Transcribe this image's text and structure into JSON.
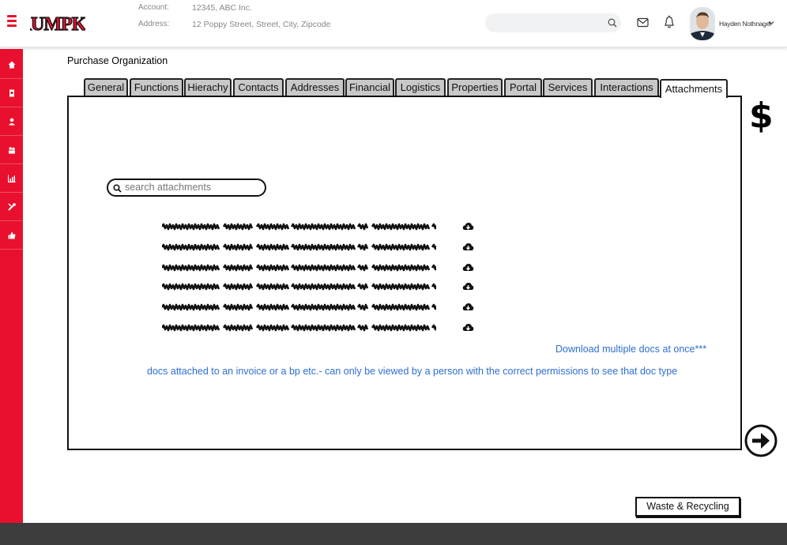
{
  "app": {
    "logo_text": "RUMPKE"
  },
  "header": {
    "account_label": "Account:",
    "account_value": "12345, ABC Inc.",
    "address_label": "Address:",
    "address_value": "12 Poppy Street, Street, City, Zipcode",
    "search_placeholder": "",
    "user_name": "Hayden Nothnagel"
  },
  "sidebar": {
    "items": [
      {
        "icon": "home-icon"
      },
      {
        "icon": "document-icon"
      },
      {
        "icon": "user-icon"
      },
      {
        "icon": "users-icon"
      },
      {
        "icon": "chart-icon"
      },
      {
        "icon": "tools-icon"
      },
      {
        "icon": "thumbs-up-icon"
      }
    ]
  },
  "page": {
    "title": "Purchase Organization"
  },
  "tabs": [
    {
      "label": "General"
    },
    {
      "label": "Functions"
    },
    {
      "label": "Hierachy"
    },
    {
      "label": "Contacts"
    },
    {
      "label": "Addresses"
    },
    {
      "label": "Financial"
    },
    {
      "label": "Logistics"
    },
    {
      "label": "Properties"
    },
    {
      "label": "Portal"
    },
    {
      "label": "Services"
    },
    {
      "label": "Interactions"
    },
    {
      "label": "Attachments",
      "active": true
    }
  ],
  "attachments": {
    "search_placeholder": "search attachments",
    "rows": 6,
    "download_multiple": "Download multiple docs at once***",
    "note": "docs attached to an invoice or a bp etc.- can only be viewed by a person with the correct permissions to see that doc type"
  },
  "side_symbol": "$",
  "footer_button": "Waste & Recycling",
  "colors": {
    "brand_red": "#e8102e",
    "link_blue": "#2f6fd1",
    "footer_gray": "#3d3d3d",
    "tab_gray": "#c8c8c8"
  }
}
